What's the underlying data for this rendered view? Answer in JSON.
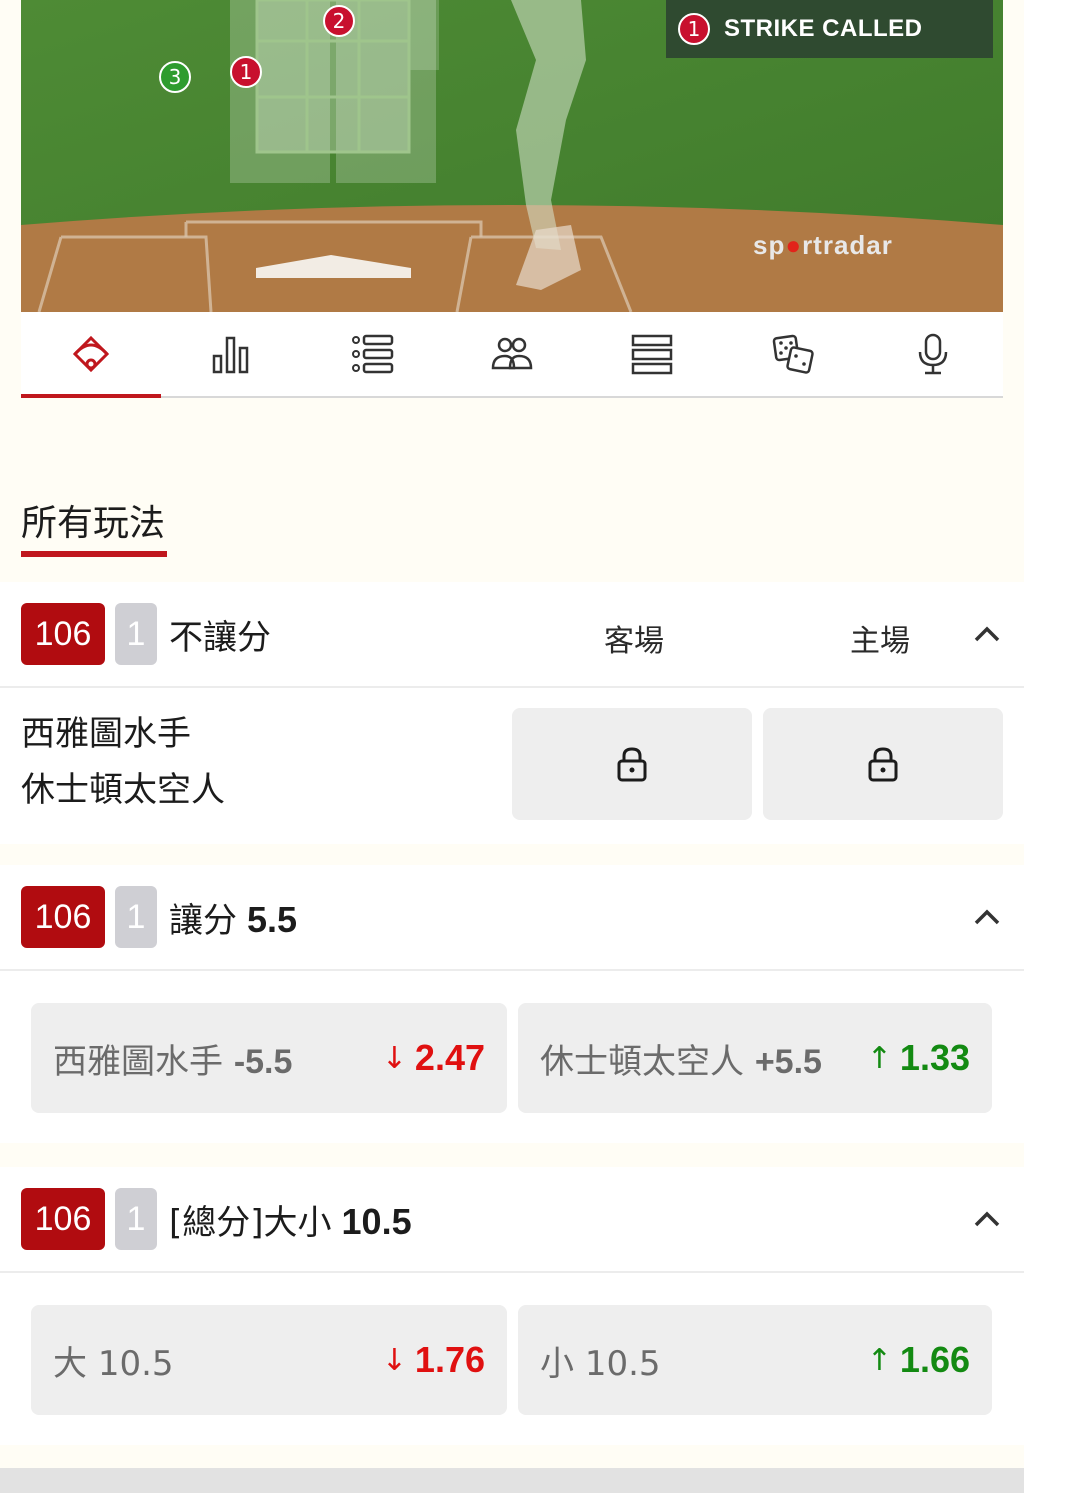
{
  "field": {
    "pitches": [
      {
        "number": "2",
        "kind": "strike"
      },
      {
        "number": "1",
        "kind": "strike"
      },
      {
        "number": "3",
        "kind": "ball"
      }
    ],
    "event": {
      "number": "1",
      "text": "STRIKE CALLED"
    },
    "brand": {
      "part1": "sp",
      "part2": "rt",
      "part3": "radar"
    }
  },
  "tabs": [
    {
      "icon": "baseball-diamond-icon",
      "active": true
    },
    {
      "icon": "bar-chart-icon",
      "active": false
    },
    {
      "icon": "list-icon",
      "active": false
    },
    {
      "icon": "players-icon",
      "active": false
    },
    {
      "icon": "lineup-icon",
      "active": false
    },
    {
      "icon": "dice-icon",
      "active": false
    },
    {
      "icon": "microphone-icon",
      "active": false
    }
  ],
  "section": {
    "title": "所有玩法"
  },
  "markets": [
    {
      "id": "106",
      "count": "1",
      "name": "不讓分",
      "line": "",
      "away_label": "客場",
      "home_label": "主場",
      "teams": [
        "西雅圖水手",
        "休士頓太空人"
      ],
      "locked": true
    },
    {
      "id": "106",
      "count": "1",
      "name": "讓分",
      "line": "5.5",
      "options": [
        {
          "label": "西雅圖水手",
          "handicap": "-5.5",
          "arrow": "↓",
          "odds": "2.47",
          "trend": "down"
        },
        {
          "label": "休士頓太空人",
          "handicap": "+5.5",
          "arrow": "↑",
          "odds": "1.33",
          "trend": "up"
        }
      ]
    },
    {
      "id": "106",
      "count": "1",
      "name": "[總分]大小",
      "line": "10.5",
      "options": [
        {
          "label": "大",
          "handicap": "10.5",
          "arrow": "↓",
          "odds": "1.76",
          "trend": "down"
        },
        {
          "label": "小",
          "handicap": "10.5",
          "arrow": "↑",
          "odds": "1.66",
          "trend": "up"
        }
      ]
    }
  ],
  "colors": {
    "accent": "#c0171d",
    "badge": "#b10c10",
    "odds_down": "#e01010",
    "odds_up": "#138a12",
    "field_green": "#4f8a36",
    "dirt": "#b07a45"
  }
}
